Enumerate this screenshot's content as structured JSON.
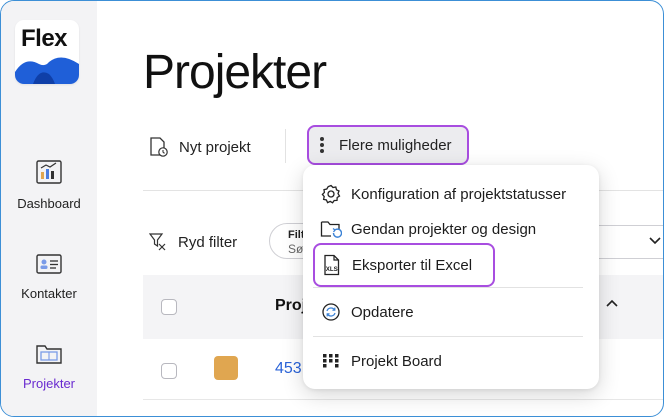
{
  "app": {
    "logo_text": "Flex"
  },
  "sidebar": {
    "items": [
      {
        "label": "Dashboard",
        "icon": "dashboard-icon"
      },
      {
        "label": "Kontakter",
        "icon": "contact-card-icon"
      },
      {
        "label": "Projekter",
        "icon": "project-folder-icon",
        "active": true
      }
    ]
  },
  "page": {
    "title": "Projekter"
  },
  "toolbar": {
    "new_project_label": "Nyt projekt",
    "more_label": "Flere muligheder"
  },
  "filter": {
    "clear_label": "Ryd filter",
    "pill_label": "Filt",
    "pill_value": "Sø"
  },
  "table": {
    "header_col": "Proj",
    "rows": [
      {
        "number": "453"
      }
    ]
  },
  "menu": {
    "items": [
      {
        "label": "Konfiguration af projektstatusser",
        "icon": "gear-icon"
      },
      {
        "label": "Gendan projekter og design",
        "icon": "restore-folder-icon"
      },
      {
        "label": "Eksporter til Excel",
        "icon": "xls-file-icon"
      },
      {
        "label": "Opdatere",
        "icon": "refresh-icon"
      },
      {
        "label": "Projekt Board",
        "icon": "board-icon"
      }
    ]
  },
  "colors": {
    "accent": "#a84de0",
    "active_nav": "#6a2bd0",
    "link": "#2a63d8",
    "swatch": "#e0a650"
  }
}
